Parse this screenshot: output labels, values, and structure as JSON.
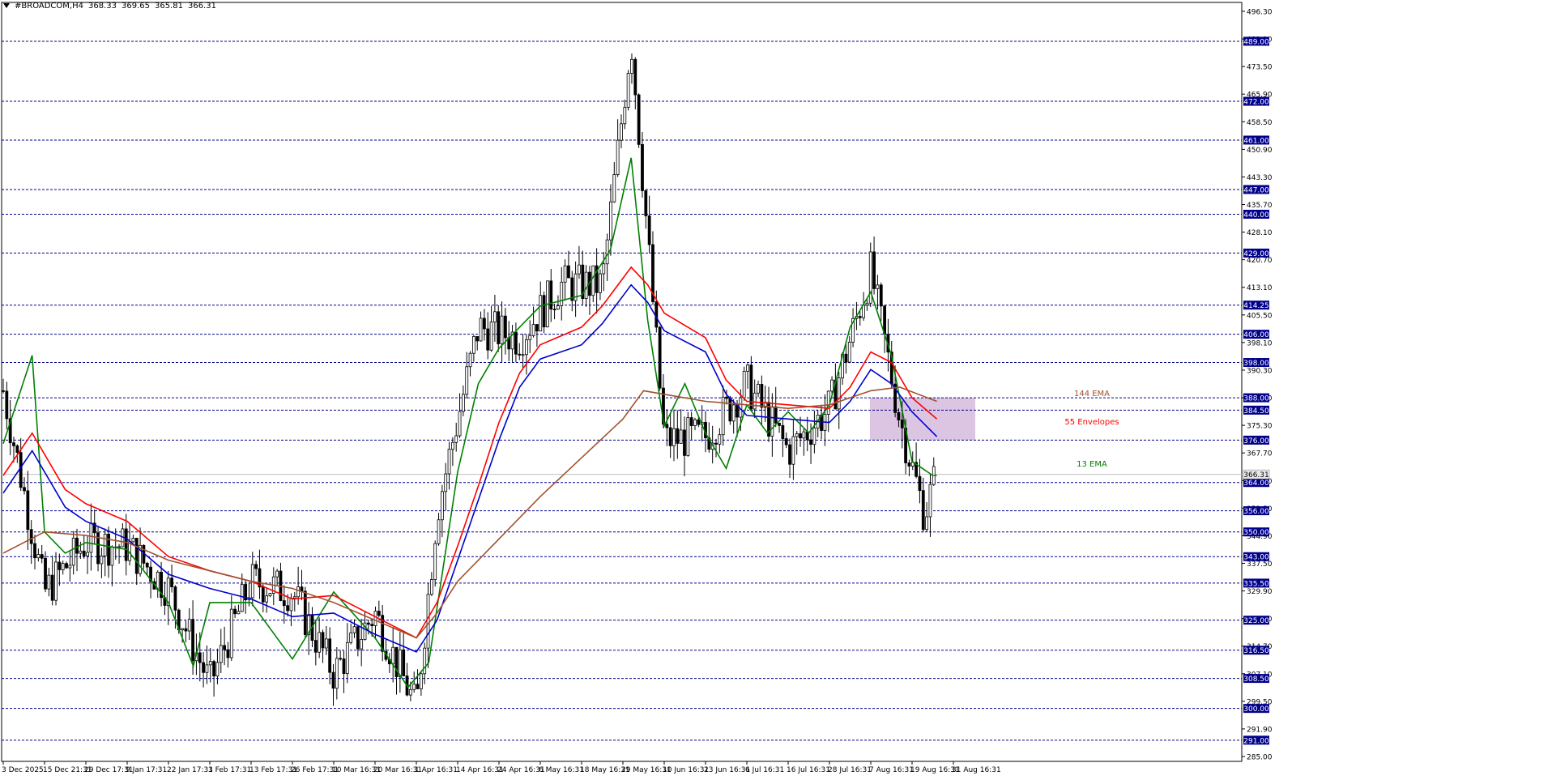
{
  "header": {
    "symbol": "#BROADCOM,H4",
    "open": "368.33",
    "high": "369.65",
    "low": "365.81",
    "close": "366.31"
  },
  "colors": {
    "ema13": "#008000",
    "envelope_upper": "#ff0000",
    "envelope_lower": "#0000cc",
    "ema144": "#a0522d",
    "zone": "#d8bfe0",
    "level_line": "#00008b",
    "badge_bg": "#00008b",
    "candle": "#000000",
    "grid": "#c0c0c0"
  },
  "chart_data": {
    "type": "candlestick",
    "title": "#BROADCOM,H4",
    "ylim": [
      285.0,
      500.0
    ],
    "x_ticks": [
      "3 Dec 2025",
      "15 Dec 21:31",
      "29 Dec 17:31",
      "9 Jan 17:31",
      "22 Jan 17:31",
      "3 Feb 17:31",
      "13 Feb 17:31",
      "26 Feb 17:31",
      "10 Mar 16:31",
      "20 Mar 16:31",
      "1 Apr 16:31",
      "14 Apr 16:31",
      "24 Apr 16:31",
      "6 May 16:31",
      "18 May 16:31",
      "29 May 16:31",
      "10 Jun 16:31",
      "23 Jun 16:31",
      "6 Jul 16:31",
      "16 Jul 16:31",
      "28 Jul 16:31",
      "7 Aug 16:31",
      "19 Aug 16:31",
      "31 Aug 16:31"
    ],
    "y_ticks": [
      "496.30",
      "481.10",
      "473.50",
      "465.90",
      "458.50",
      "450.90",
      "443.30",
      "435.70",
      "428.10",
      "420.70",
      "413.10",
      "405.50",
      "398.10",
      "390.30",
      "382.70",
      "375.30",
      "367.70",
      "360.10",
      "352.50",
      "344.90",
      "337.50",
      "329.90",
      "322.30",
      "314.70",
      "307.10",
      "299.50",
      "291.90",
      "285.00"
    ],
    "levels": [
      "489.00",
      "472.00",
      "461.00",
      "447.00",
      "440.00",
      "429.00",
      "414.25",
      "406.00",
      "398.00",
      "388.00",
      "384.50",
      "376.00",
      "364.00",
      "356.00",
      "350.00",
      "343.00",
      "335.50",
      "325.00",
      "316.50",
      "308.50",
      "300.00",
      "291.00"
    ],
    "current_price": "366.31",
    "zone": {
      "x_from": "7 Aug 16:31",
      "x_to": "31 Aug 16:31",
      "y_from": 376.0,
      "y_to": 388.0
    },
    "path_x_ticks": [
      0,
      1,
      2,
      3,
      4,
      5,
      6,
      7,
      8,
      9,
      10,
      11,
      12,
      13,
      14,
      15,
      16,
      17,
      18,
      19,
      20,
      21,
      22,
      22.5
    ],
    "price_path": [
      390,
      333,
      347,
      346,
      334,
      307,
      336,
      333,
      310,
      327,
      300,
      356,
      408,
      405,
      420,
      420,
      490,
      376,
      377,
      392,
      373,
      385,
      424,
      382,
      355,
      367
    ],
    "price_path_x": [
      0,
      1,
      2,
      3,
      4,
      5,
      6,
      7,
      8,
      9,
      10,
      10.5,
      11.5,
      12.5,
      13.5,
      14.5,
      15.2,
      16,
      17,
      18,
      19,
      20,
      21,
      21.7,
      22.3,
      22.6
    ],
    "series": [
      {
        "name": "13 EMA",
        "points": [
          [
            0,
            375
          ],
          [
            0.7,
            400
          ],
          [
            1,
            350
          ],
          [
            1.5,
            344
          ],
          [
            2,
            347
          ],
          [
            3,
            345
          ],
          [
            4,
            330
          ],
          [
            4.6,
            312
          ],
          [
            5,
            330
          ],
          [
            6,
            330
          ],
          [
            7,
            314
          ],
          [
            8,
            333
          ],
          [
            9,
            320
          ],
          [
            9.8,
            306
          ],
          [
            10.3,
            313
          ],
          [
            11,
            367
          ],
          [
            11.5,
            392
          ],
          [
            12,
            402
          ],
          [
            13,
            414
          ],
          [
            14,
            417
          ],
          [
            14.7,
            430
          ],
          [
            15.2,
            456
          ],
          [
            15.6,
            410
          ],
          [
            16,
            380
          ],
          [
            16.5,
            392
          ],
          [
            17,
            378
          ],
          [
            17.5,
            368
          ],
          [
            18,
            386
          ],
          [
            18.5,
            378
          ],
          [
            19,
            384
          ],
          [
            19.5,
            378
          ],
          [
            20,
            386
          ],
          [
            20.5,
            408
          ],
          [
            21,
            418
          ],
          [
            21.5,
            400
          ],
          [
            22,
            370
          ],
          [
            22.5,
            366
          ],
          [
            22.6,
            366
          ]
        ]
      },
      {
        "name": "55 Envelopes",
        "points": [
          [
            0,
            366
          ],
          [
            0.7,
            378
          ],
          [
            1.5,
            362
          ],
          [
            2,
            358
          ],
          [
            3,
            353
          ],
          [
            4,
            343
          ],
          [
            5,
            339
          ],
          [
            6,
            336
          ],
          [
            7,
            331
          ],
          [
            8,
            332
          ],
          [
            9,
            326
          ],
          [
            10,
            320
          ],
          [
            10.5,
            330
          ],
          [
            11,
            346
          ],
          [
            11.5,
            363
          ],
          [
            12,
            381
          ],
          [
            12.5,
            395
          ],
          [
            13,
            403
          ],
          [
            14,
            408
          ],
          [
            14.5,
            414
          ],
          [
            15.2,
            425
          ],
          [
            15.6,
            420
          ],
          [
            16,
            412
          ],
          [
            17,
            405
          ],
          [
            17.5,
            393
          ],
          [
            18,
            387
          ],
          [
            19,
            386
          ],
          [
            20,
            385
          ],
          [
            20.5,
            391
          ],
          [
            21,
            401
          ],
          [
            21.5,
            398
          ],
          [
            22,
            388
          ],
          [
            22.6,
            382
          ]
        ]
      },
      {
        "name": "envelope-lower",
        "points": [
          [
            0,
            361
          ],
          [
            0.7,
            373
          ],
          [
            1.5,
            357
          ],
          [
            2,
            353
          ],
          [
            3,
            348
          ],
          [
            4,
            338
          ],
          [
            5,
            334
          ],
          [
            6,
            331
          ],
          [
            7,
            326
          ],
          [
            8,
            327
          ],
          [
            9,
            321
          ],
          [
            10,
            316
          ],
          [
            10.5,
            325
          ],
          [
            11,
            342
          ],
          [
            11.5,
            359
          ],
          [
            12,
            376
          ],
          [
            12.5,
            391
          ],
          [
            13,
            399
          ],
          [
            14,
            403
          ],
          [
            14.5,
            409
          ],
          [
            15.2,
            420
          ],
          [
            15.6,
            415
          ],
          [
            16,
            407
          ],
          [
            17,
            401
          ],
          [
            17.5,
            389
          ],
          [
            18,
            383
          ],
          [
            19,
            382
          ],
          [
            20,
            381
          ],
          [
            20.5,
            387
          ],
          [
            21,
            396
          ],
          [
            21.5,
            392
          ],
          [
            22,
            384
          ],
          [
            22.6,
            377
          ]
        ]
      },
      {
        "name": "144 EMA",
        "points": [
          [
            0,
            344
          ],
          [
            1,
            350
          ],
          [
            2,
            349
          ],
          [
            3,
            347
          ],
          [
            4,
            342
          ],
          [
            5,
            339
          ],
          [
            6,
            336
          ],
          [
            7,
            334
          ],
          [
            8,
            330
          ],
          [
            9,
            325
          ],
          [
            10,
            320
          ],
          [
            10.5,
            327
          ],
          [
            11,
            336
          ],
          [
            12,
            348
          ],
          [
            13,
            360
          ],
          [
            14,
            371
          ],
          [
            15,
            382
          ],
          [
            15.5,
            390
          ],
          [
            16,
            389
          ],
          [
            17,
            387
          ],
          [
            18,
            386
          ],
          [
            19,
            385
          ],
          [
            20,
            386
          ],
          [
            21,
            390
          ],
          [
            21.7,
            391
          ],
          [
            22.6,
            387
          ]
        ]
      }
    ],
    "legend_labels": [
      {
        "text": "144 EMA",
        "y": 388.5
      },
      {
        "text": "55 Envelopes",
        "y": 380.5
      },
      {
        "text": "13 EMA",
        "y": 368.5
      }
    ],
    "grid": true
  }
}
